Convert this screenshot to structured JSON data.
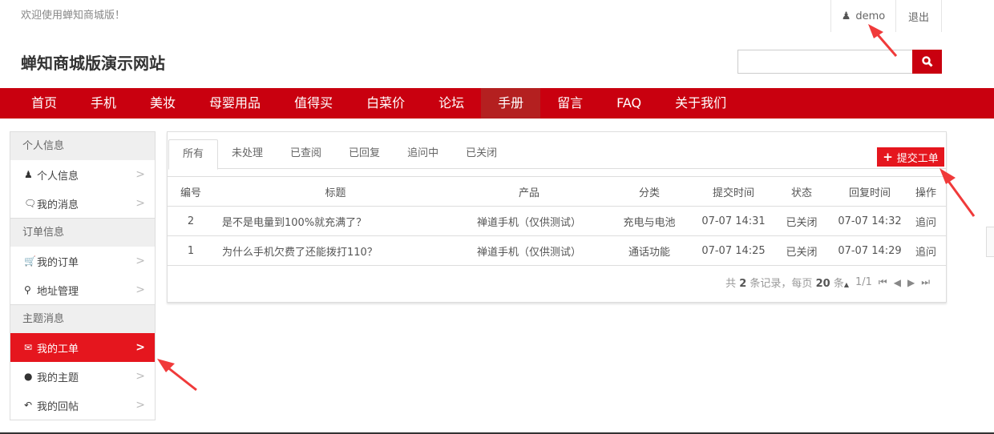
{
  "header": {
    "welcome": "欢迎使用蝉知商城版！",
    "user": "demo",
    "logout": "退出",
    "site_title": "蝉知商城版演示网站",
    "search_placeholder": ""
  },
  "nav": [
    "首页",
    "手机",
    "美妆",
    "母婴用品",
    "值得买",
    "白菜价",
    "论坛",
    "手册",
    "留言",
    "FAQ",
    "关于我们"
  ],
  "nav_active": "手册",
  "sidebar": {
    "groups": [
      {
        "title": "个人信息",
        "items": [
          {
            "label": "个人信息",
            "icon": "user-icon"
          },
          {
            "label": "我的消息",
            "icon": "comments-icon"
          }
        ]
      },
      {
        "title": "订单信息",
        "items": [
          {
            "label": "我的订单",
            "icon": "cart-icon"
          },
          {
            "label": "地址管理",
            "icon": "map-marker-icon"
          }
        ]
      },
      {
        "title": "主题消息",
        "items": [
          {
            "label": "我的工单",
            "icon": "envelope-icon",
            "active": true
          },
          {
            "label": "我的主题",
            "icon": "comment-icon"
          },
          {
            "label": "我的回帖",
            "icon": "reply-icon"
          }
        ]
      }
    ]
  },
  "tabs": [
    "所有",
    "未处理",
    "已查阅",
    "已回复",
    "追问中",
    "已关闭"
  ],
  "add_button": "提交工单",
  "table": {
    "headers": [
      "编号",
      "标题",
      "产品",
      "分类",
      "提交时间",
      "状态",
      "回复时间",
      "操作"
    ],
    "rows": [
      [
        "2",
        "是不是电量到100%就充满了？",
        "禅道手机（仅供测试）",
        "充电与电池",
        "07-07 14:31",
        "已关闭",
        "07-07 14:32",
        "追问"
      ],
      [
        "1",
        "为什么手机欠费了还能拨打110？",
        "禅道手机（仅供测试）",
        "通话功能",
        "07-07 14:25",
        "已关闭",
        "07-07 14:29",
        "追问"
      ]
    ]
  },
  "pager": {
    "prefix": "共",
    "total": "2",
    "mid": "条记录，每页",
    "per_page": "20",
    "suffix": "条",
    "page": "1/1"
  },
  "colors": {
    "brand": "#c9000f",
    "active": "#e5161e"
  }
}
